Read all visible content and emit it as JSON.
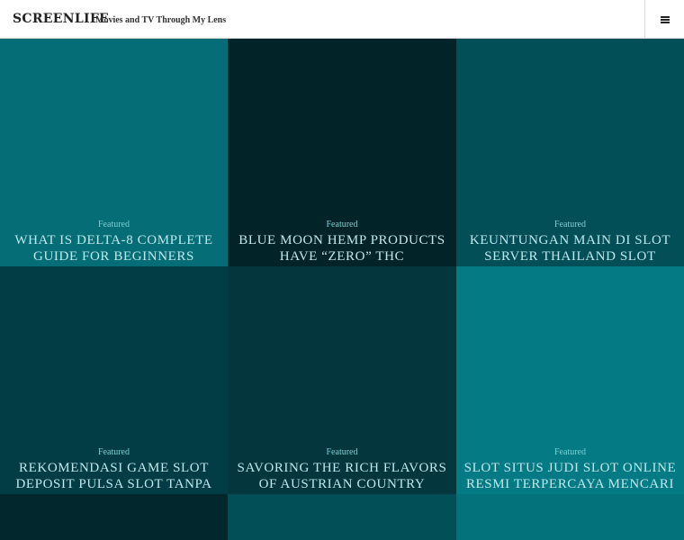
{
  "site": {
    "title": "SCREENLIFE",
    "tagline": "Movies and TV Through My Lens"
  },
  "menu": {
    "icon": "hamburger-menu-icon"
  },
  "tiles": [
    {
      "label": "Featured",
      "title": "What is Delta-8 Complete Guide for Beginners",
      "color": "#046d76"
    },
    {
      "label": "Featured",
      "title": "Blue Moon Hemp Products Have “Zero” THC",
      "color": "#022429"
    },
    {
      "label": "Featured",
      "title": "Keuntungan Main di Slot Server Thailand Slot Negeri",
      "color": "#034f58"
    },
    {
      "label": "Featured",
      "title": "Rekomendasi Game Slot Deposit Pulsa Slot Tanpa",
      "color": "#023c44"
    },
    {
      "label": "Featured",
      "title": "Savoring the Rich Flavors of Austrian Country Cuisine",
      "color": "#03363d"
    },
    {
      "label": "Featured",
      "title": "Slot Situs Judi Slot Online Resmi Terpercaya Mencari",
      "color": "#047b84"
    },
    {
      "label": "",
      "title": "",
      "color": "#02272c"
    },
    {
      "label": "",
      "title": "",
      "color": "#034f58"
    },
    {
      "label": "",
      "title": "",
      "color": "#04727b"
    }
  ]
}
